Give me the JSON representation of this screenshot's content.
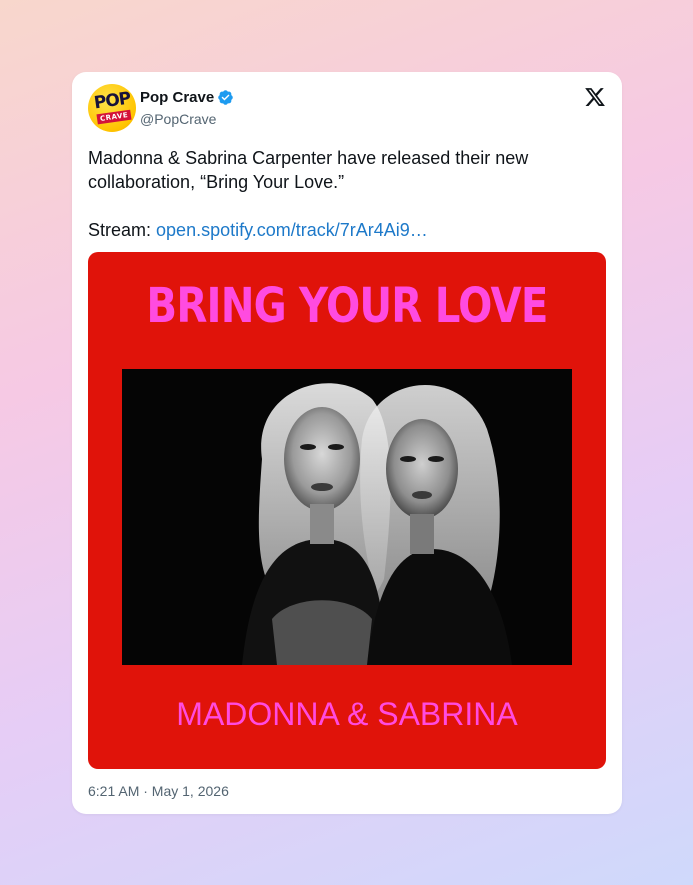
{
  "tweet": {
    "author": {
      "display_name": "Pop Crave",
      "handle": "@PopCrave",
      "avatar_text_top": "POP",
      "avatar_text_bottom": "CRAVE",
      "verified": true
    },
    "text_line1": "Madonna & Sabrina Carpenter have released their new collaboration, “Bring Your Love.”",
    "stream_prefix": "Stream: ",
    "stream_link": "open.spotify.com/track/7rAr4Ai9…",
    "media": {
      "title": "BRING YOUR LOVE",
      "artists": "MADONNA & SABRINA"
    },
    "timestamp": "6:21 AM · May 1, 2026"
  },
  "icons": {
    "verified": "verified-badge-icon",
    "platform": "x-logo-icon"
  },
  "colors": {
    "link": "#1d79c9",
    "cover_background": "#e0130a",
    "cover_text": "#ff4be0",
    "verified": "#1d9bf0"
  }
}
